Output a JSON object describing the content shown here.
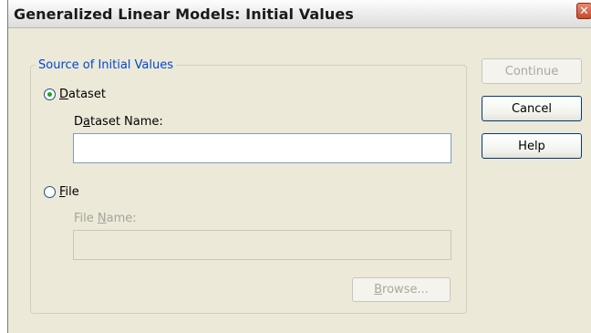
{
  "window": {
    "title": "Generalized Linear Models: Initial Values",
    "close_glyph": "✕"
  },
  "group": {
    "legend": "Source of Initial Values"
  },
  "dataset_option": {
    "mnemonic": "D",
    "label_rest": "ataset",
    "selected": true
  },
  "dataset_name": {
    "pre": "D",
    "mnemonic": "a",
    "rest": "taset Name:",
    "value": ""
  },
  "file_option": {
    "mnemonic": "F",
    "label_rest": "ile",
    "selected": false
  },
  "file_name": {
    "pre": "File ",
    "mnemonic": "N",
    "rest": "ame:",
    "value": ""
  },
  "buttons": {
    "browse": {
      "mnemonic": "B",
      "rest": "rowse..."
    },
    "continue": "Continue",
    "cancel": "Cancel",
    "help": "Help"
  }
}
